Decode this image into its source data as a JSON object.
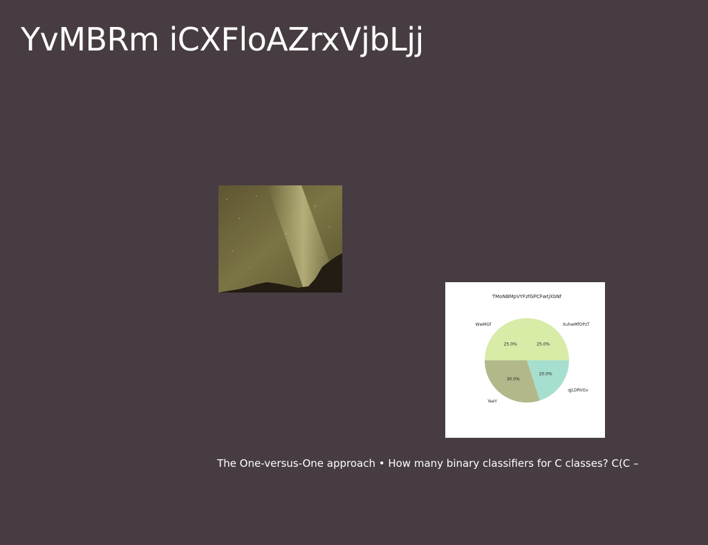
{
  "slide": {
    "title": "YvMBRm iCXFloAZrxVjbLjj",
    "caption": "The One-versus-One approach • How many binary classifiers for C classes? C(C –"
  },
  "colors": {
    "background": "#473c42",
    "text": "#ffffff"
  },
  "chart_data": {
    "type": "pie",
    "title": "TMoNBMpVYFzfGPCFwtjXbNf",
    "categories": [
      "XuhwMfOPzT",
      "qjLDRVGv",
      "YaeY",
      "WwMGf"
    ],
    "values": [
      25.0,
      20.0,
      30.0,
      25.0
    ],
    "value_labels": [
      "25.0%",
      "20.0%",
      "30.0%",
      "25.0%"
    ],
    "colors": [
      "#d8eba7",
      "#a6dfcf",
      "#b3b88a",
      "#d8eba7"
    ],
    "legend": "none"
  }
}
